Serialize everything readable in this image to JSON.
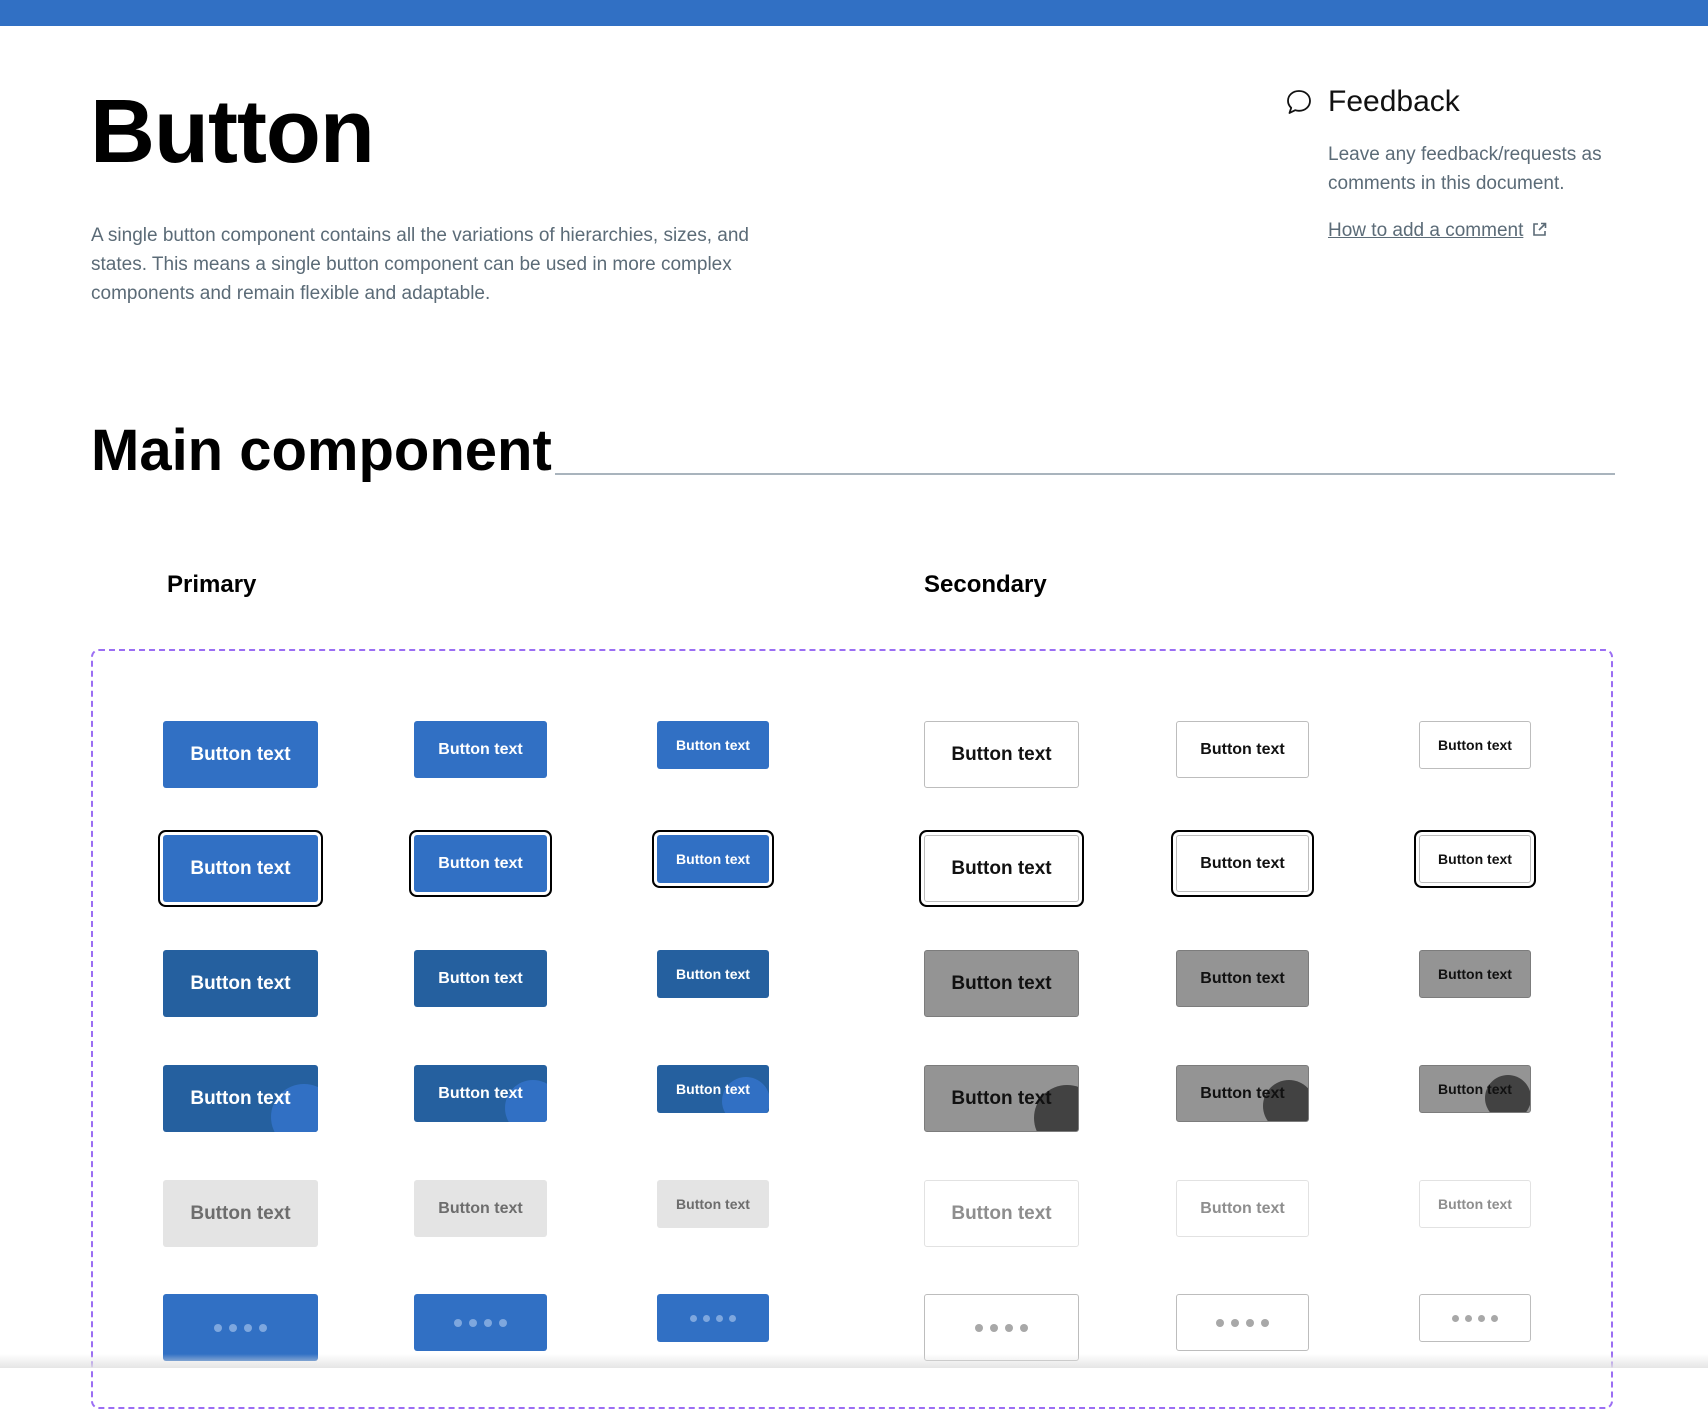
{
  "page": {
    "title": "Button",
    "intro": "A single button component contains all the variations of hierarchies, sizes, and states. This means a single button component can be used in more complex components and remain flexible and adaptable."
  },
  "feedback": {
    "title": "Feedback",
    "text": "Leave any feedback/requests as comments in this document.",
    "link": "How to add a comment",
    "icon": "speech-bubble-icon",
    "link_icon": "external-link-icon"
  },
  "section": {
    "title": "Main component"
  },
  "columns": {
    "primary": "Primary",
    "secondary": "Secondary"
  },
  "button_label": "Button text",
  "colors": {
    "accent": "#3170C4",
    "accent_pressed": "#25609F",
    "frame_dash": "#9B6EF3",
    "secondary_pressed": "#949494",
    "disabled_fill": "#E4E4E4"
  },
  "states": [
    "default",
    "focused",
    "hover",
    "pressed",
    "disabled",
    "loading"
  ],
  "hierarchies": [
    "primary",
    "secondary"
  ],
  "sizes": [
    "large",
    "medium",
    "small"
  ]
}
